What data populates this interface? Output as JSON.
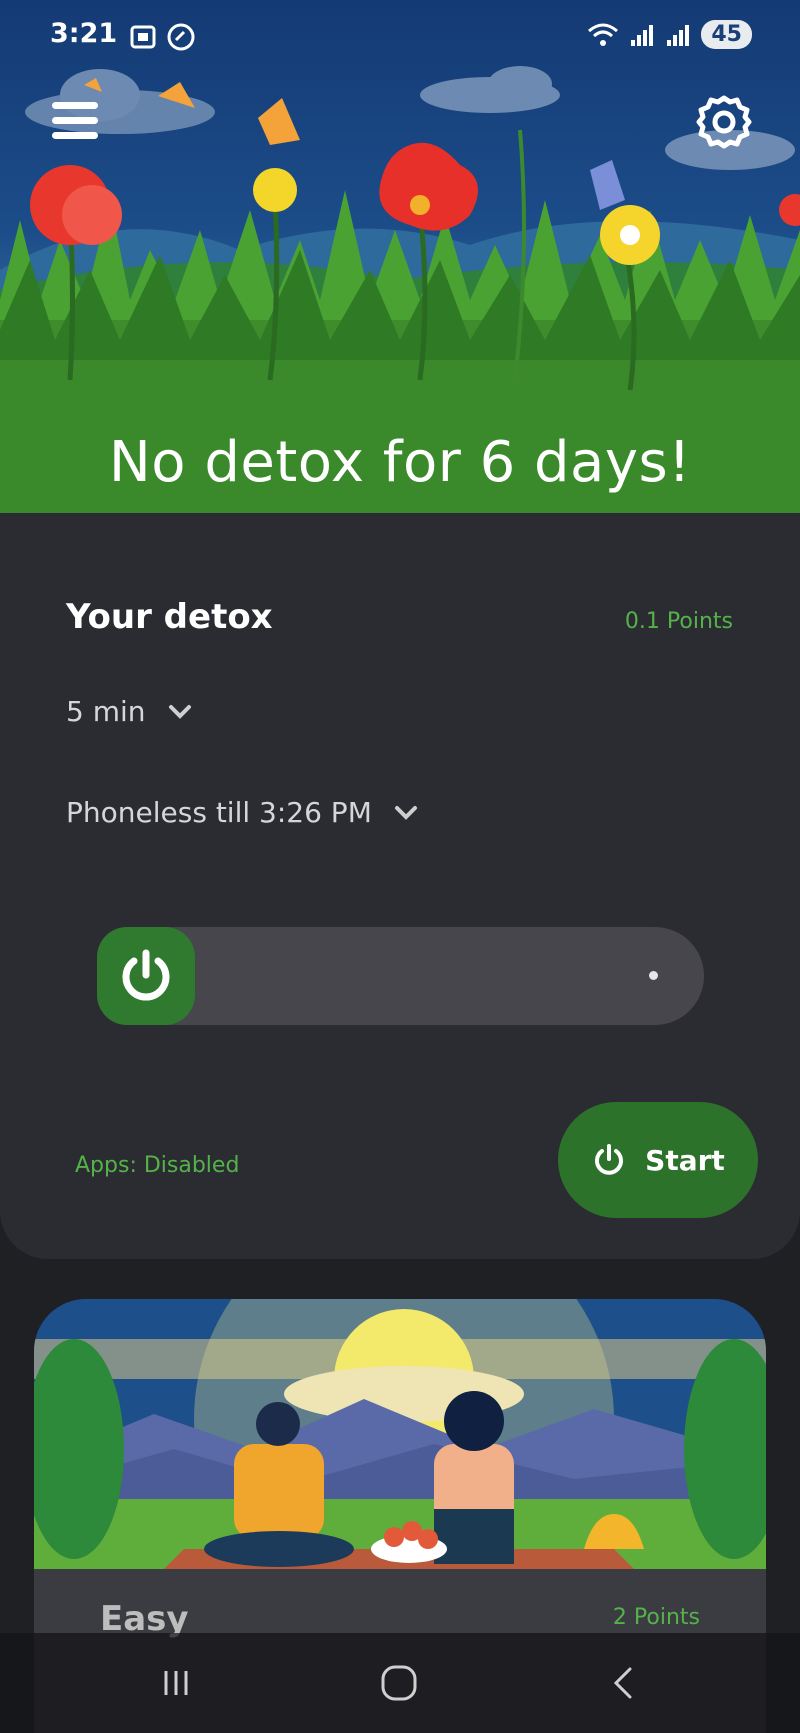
{
  "status_bar": {
    "time": "3:21",
    "battery": "45",
    "icons": [
      "screenshot-icon",
      "call-icon",
      "wifi-icon",
      "signal-icon",
      "signal-icon"
    ]
  },
  "header": {
    "menu_icon": "hamburger-menu-icon",
    "settings_icon": "gear-icon",
    "title": "No detox for 6 days!"
  },
  "detox": {
    "title": "Your detox",
    "points": "0.1 Points",
    "duration": "5 min",
    "until": "Phoneless till 3:26 PM",
    "apps_status": "Apps: Disabled",
    "start_label": "Start",
    "slider_progress": 0
  },
  "level": {
    "name": "Easy",
    "points": "2 Points"
  },
  "nav": {
    "buttons": [
      "recents",
      "home",
      "back"
    ]
  },
  "colors": {
    "accent": "#2c722a",
    "accent_text": "#55b24a",
    "card_bg": "#2b2c31",
    "page_bg": "#1f2024"
  }
}
